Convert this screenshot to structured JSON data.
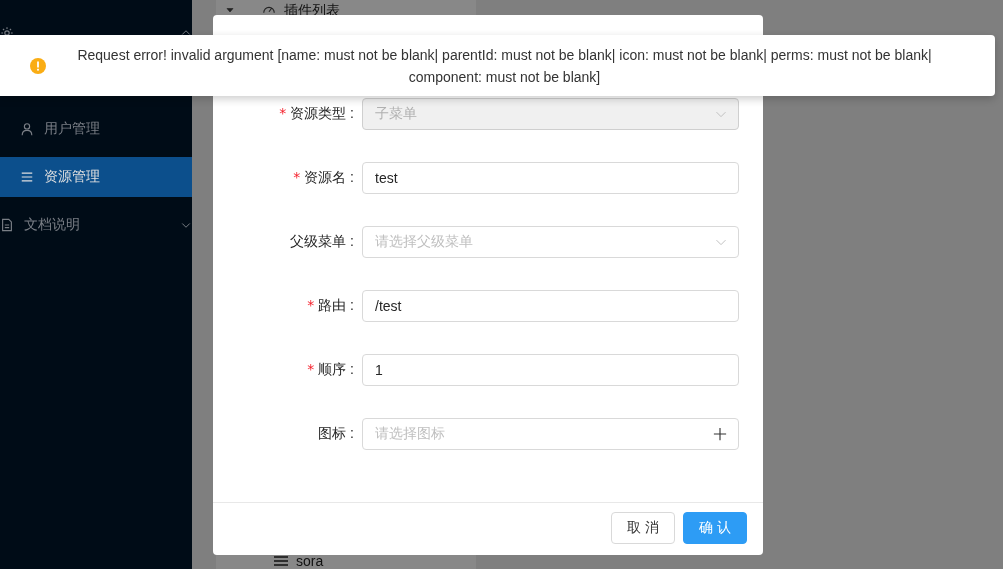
{
  "sidebar": {
    "items": [
      {
        "kind": "group",
        "expanded": true,
        "selected": false
      },
      {
        "kind": "hidden"
      },
      {
        "kind": "item",
        "label": "用户管理",
        "selected": false
      },
      {
        "kind": "item",
        "label": "资源管理",
        "selected": true
      },
      {
        "kind": "group",
        "label": "文档说明",
        "expanded": false,
        "selected": false
      }
    ]
  },
  "tree": {
    "top": {
      "label": "插件列表",
      "expanded": true
    },
    "bottom": {
      "label": "sora"
    }
  },
  "modal": {
    "required_mark": "*",
    "fields": [
      {
        "kind": "select",
        "label": "资源类型 :",
        "required": true,
        "value": "子菜单",
        "disabled": true
      },
      {
        "kind": "input",
        "label": "资源名 :",
        "required": true,
        "value": "test",
        "disabled": false
      },
      {
        "kind": "select",
        "label": "父级菜单 :",
        "required": false,
        "placeholder": "请选择父级菜单",
        "disabled": false
      },
      {
        "kind": "input",
        "label": "路由 :",
        "required": true,
        "value": "/test",
        "disabled": false
      },
      {
        "kind": "input",
        "label": "顺序 :",
        "required": true,
        "value": "1",
        "disabled": false
      },
      {
        "kind": "picker",
        "label": "图标 :",
        "required": false,
        "placeholder": "请选择图标",
        "disabled": false
      }
    ],
    "buttons": [
      {
        "label": "取 消",
        "primary": false
      },
      {
        "label": "确 认",
        "primary": true
      }
    ]
  },
  "toast": {
    "kind": "warning",
    "message": "Request error! invalid argument [name: must not be blank| parentId: must not be blank| icon: must not be blank| perms: must not be blank| component: must not be blank]"
  }
}
